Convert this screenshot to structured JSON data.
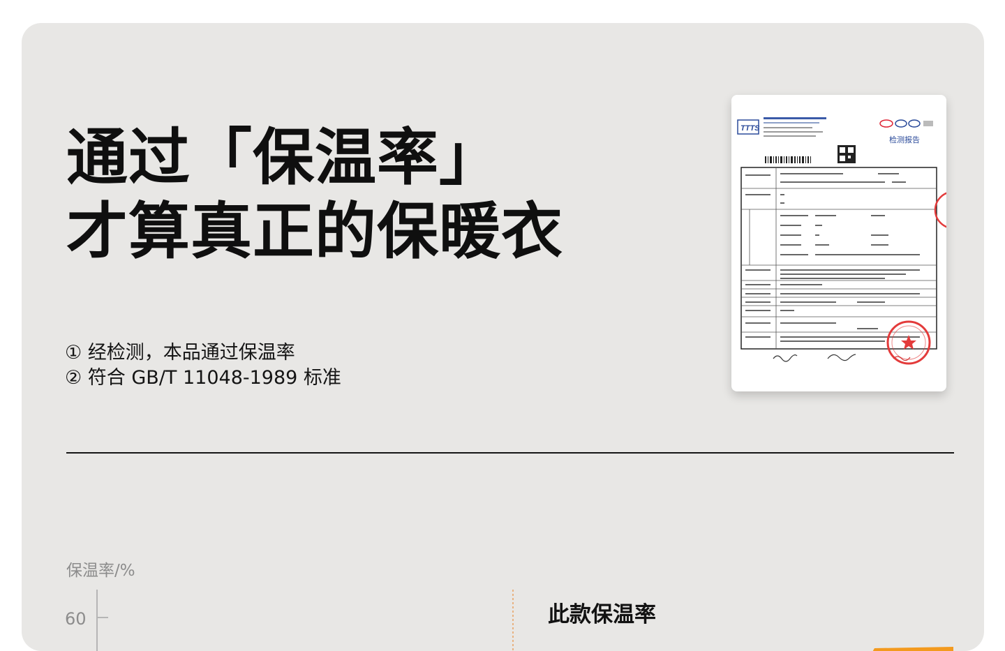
{
  "headline": {
    "line1": "通过「保温率」",
    "line2": "才算真正的保暖衣"
  },
  "notes": [
    "① 经检测，本品通过保温率",
    "② 符合 GB/T 11048-1989 标准"
  ],
  "report_image": {
    "logo_text": "TTTS",
    "title": "检测报告"
  },
  "chart": {
    "ylabel": "保温率/%",
    "tick_60": "60",
    "callout": "此款保温率"
  },
  "chart_data": {
    "type": "bar",
    "ylabel": "保温率/%",
    "y_ticks": [
      60
    ],
    "annotations": [
      "此款保温率"
    ],
    "colors": {
      "bar": "#f39a1e",
      "guide": "#e8a060"
    }
  },
  "colors": {
    "background": "#e8e7e5",
    "text": "#0f0f0f",
    "muted": "#8c8c8c",
    "accent": "#f39a1e",
    "stamp": "#e33b3b"
  }
}
